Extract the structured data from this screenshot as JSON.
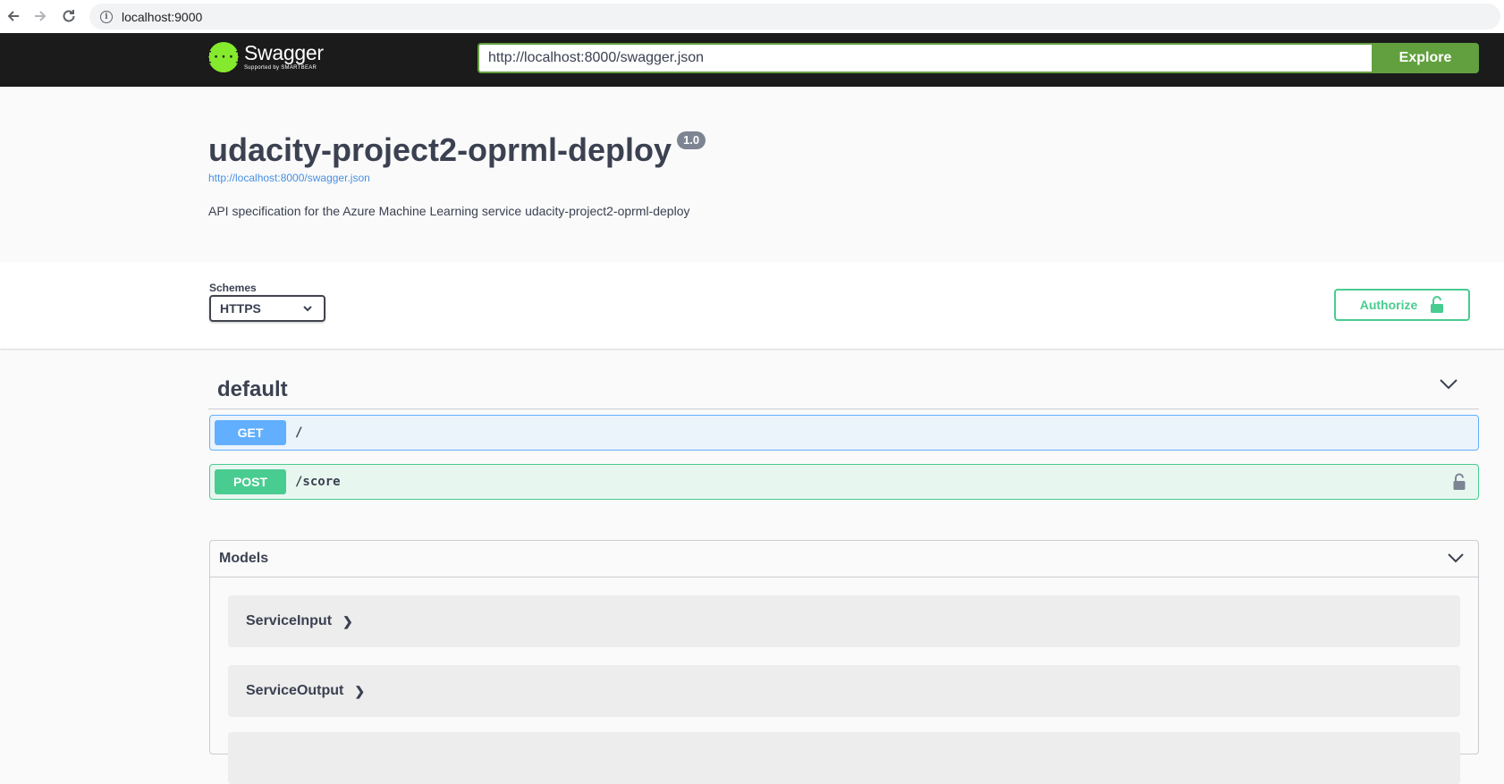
{
  "browser": {
    "url": "localhost:9000"
  },
  "topbar": {
    "logo_word": "Swagger",
    "logo_sub": "Supported by SMARTBEAR",
    "spec_url": "http://localhost:8000/swagger.json",
    "explore_label": "Explore"
  },
  "info": {
    "title": "udacity-project2-oprml-deploy",
    "version": "1.0",
    "spec_link": "http://localhost:8000/swagger.json",
    "description": "API specification for the Azure Machine Learning service udacity-project2-oprml-deploy"
  },
  "schemes": {
    "label": "Schemes",
    "selected": "HTTPS"
  },
  "authorize_label": "Authorize",
  "tag": {
    "name": "default"
  },
  "operations": [
    {
      "method": "GET",
      "path": "/"
    },
    {
      "method": "POST",
      "path": "/score"
    }
  ],
  "models": {
    "title": "Models",
    "items": [
      {
        "name": "ServiceInput"
      },
      {
        "name": "ServiceOutput"
      }
    ]
  },
  "colors": {
    "get": "#61affe",
    "post": "#49cc90",
    "explore": "#62a03f",
    "topbar": "#1b1b1b"
  }
}
